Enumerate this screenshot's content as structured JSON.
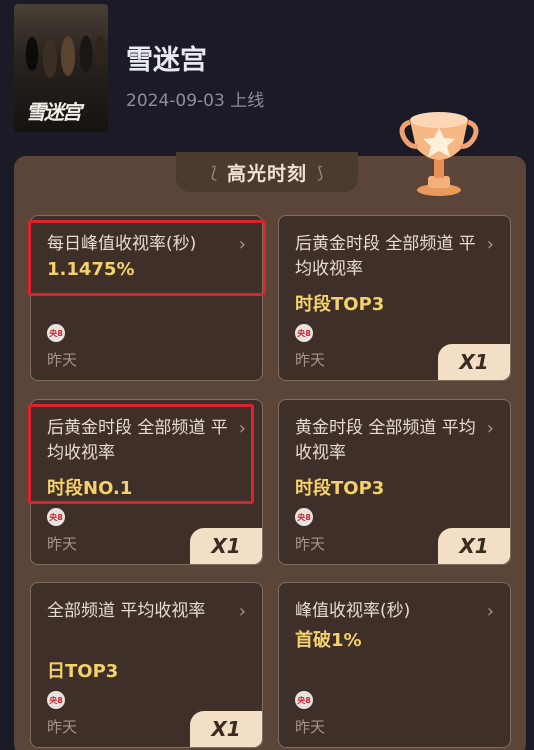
{
  "show": {
    "title": "雪迷宫",
    "release": "2024-09-03 上线",
    "poster_logo": "雪迷宫"
  },
  "panel": {
    "heading": "高光时刻"
  },
  "cards": [
    {
      "label": "每日峰值收视率(秒)",
      "value": "1.1475%",
      "channel_icon": "cctv8-icon",
      "channel_text": "央8",
      "when": "昨天",
      "badge": ""
    },
    {
      "label": "后黄金时段 全部频道 平均收视率",
      "value": "时段TOP3",
      "channel_icon": "cctv8-icon",
      "channel_text": "央8",
      "when": "昨天",
      "badge": "X1"
    },
    {
      "label": "后黄金时段 全部频道 平均收视率",
      "value": "时段NO.1",
      "channel_icon": "cctv8-icon",
      "channel_text": "央8",
      "when": "昨天",
      "badge": "X1"
    },
    {
      "label": "黄金时段 全部频道 平均收视率",
      "value": "时段TOP3",
      "channel_icon": "cctv8-icon",
      "channel_text": "央8",
      "when": "昨天",
      "badge": "X1"
    },
    {
      "label": "全部频道 平均收视率",
      "value": "日TOP3",
      "channel_icon": "cctv8-icon",
      "channel_text": "央8",
      "when": "昨天",
      "badge": "X1"
    },
    {
      "label": "峰值收视率(秒)",
      "value": "首破1%",
      "channel_icon": "cctv8-icon",
      "channel_text": "央8",
      "when": "昨天",
      "badge": ""
    }
  ],
  "chevron": "›",
  "colors": {
    "highlight": "#e0212a",
    "value_gold": "#f4d16a",
    "badge_bg": "#f3dfc6"
  }
}
